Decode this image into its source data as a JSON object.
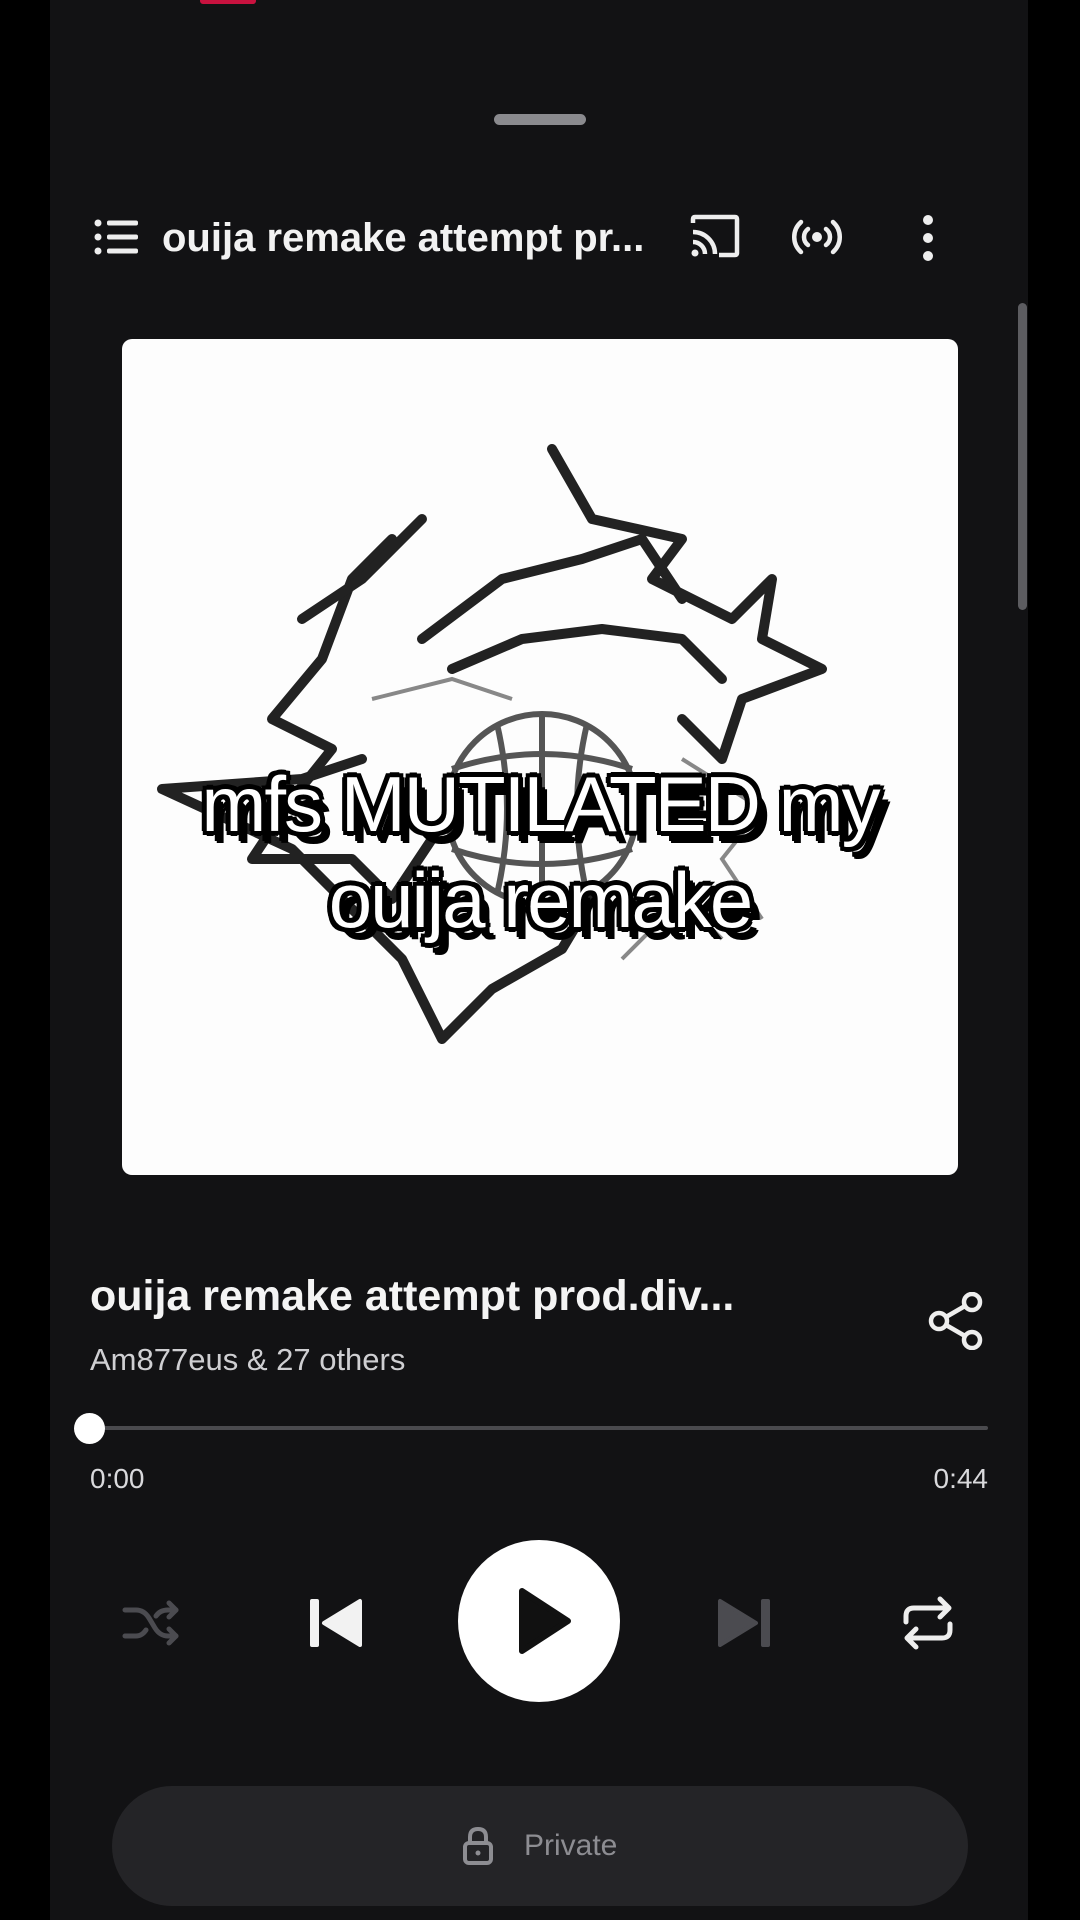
{
  "header": {
    "title": "ouija remake attempt pr..."
  },
  "artwork": {
    "overlay_line1": "mfs MUTILATED my",
    "overlay_line2": "ouija remake"
  },
  "track": {
    "title": "ouija remake attempt prod.div...",
    "artist": "Am877eus & 27 others"
  },
  "playback": {
    "current_time": "0:00",
    "total_time": "0:44",
    "progress": 0
  },
  "footer": {
    "private_label": "Private"
  },
  "icons": {
    "queue": "list-icon",
    "cast": "cast-icon",
    "broadcast": "broadcast-icon",
    "more": "more-vertical-icon",
    "share": "share-icon",
    "shuffle": "shuffle-icon",
    "previous": "skip-previous-icon",
    "play": "play-icon",
    "next": "skip-next-icon",
    "repeat": "repeat-icon",
    "lock": "lock-icon"
  },
  "colors": {
    "background": "#121214",
    "accent": "#c8123f",
    "text": "#f4f4f4",
    "muted": "#8d8d92"
  }
}
